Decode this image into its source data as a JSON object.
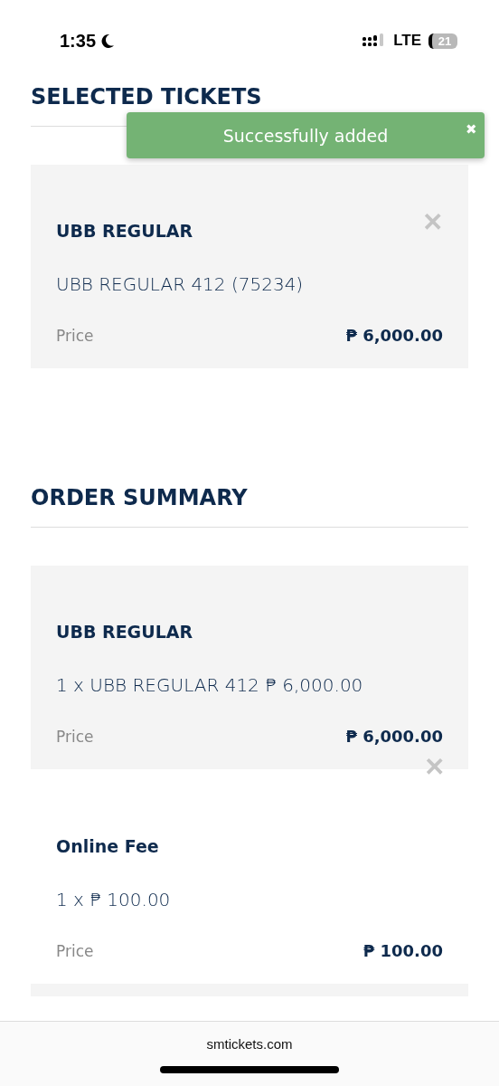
{
  "status_bar": {
    "time": "1:35",
    "network": "LTE",
    "battery": "21"
  },
  "toast": {
    "message": "Successfully added",
    "close": "✖"
  },
  "sections": [
    {
      "title": "SELECTED TICKETS",
      "items": [
        {
          "kind": "ticket",
          "shaded": true,
          "name": "UBB REGULAR",
          "detail": "UBB REGULAR 412 (75234)",
          "price_label": "Price",
          "price": "₱ 6,000.00",
          "remove": "✕"
        }
      ]
    },
    {
      "title": "ORDER SUMMARY",
      "items": [
        {
          "kind": "summary",
          "shaded": true,
          "name": "UBB REGULAR",
          "detail": "1 x UBB REGULAR 412 ₱ 6,000.00",
          "price_label": "Price",
          "price": "₱ 6,000.00",
          "remove": "✕"
        },
        {
          "kind": "fee",
          "shaded": false,
          "name": "Online Fee",
          "detail": "1 x ₱ 100.00",
          "price_label": "Price",
          "price": "₱ 100.00"
        }
      ]
    }
  ],
  "browser_bar": {
    "url": "smtickets.com"
  }
}
